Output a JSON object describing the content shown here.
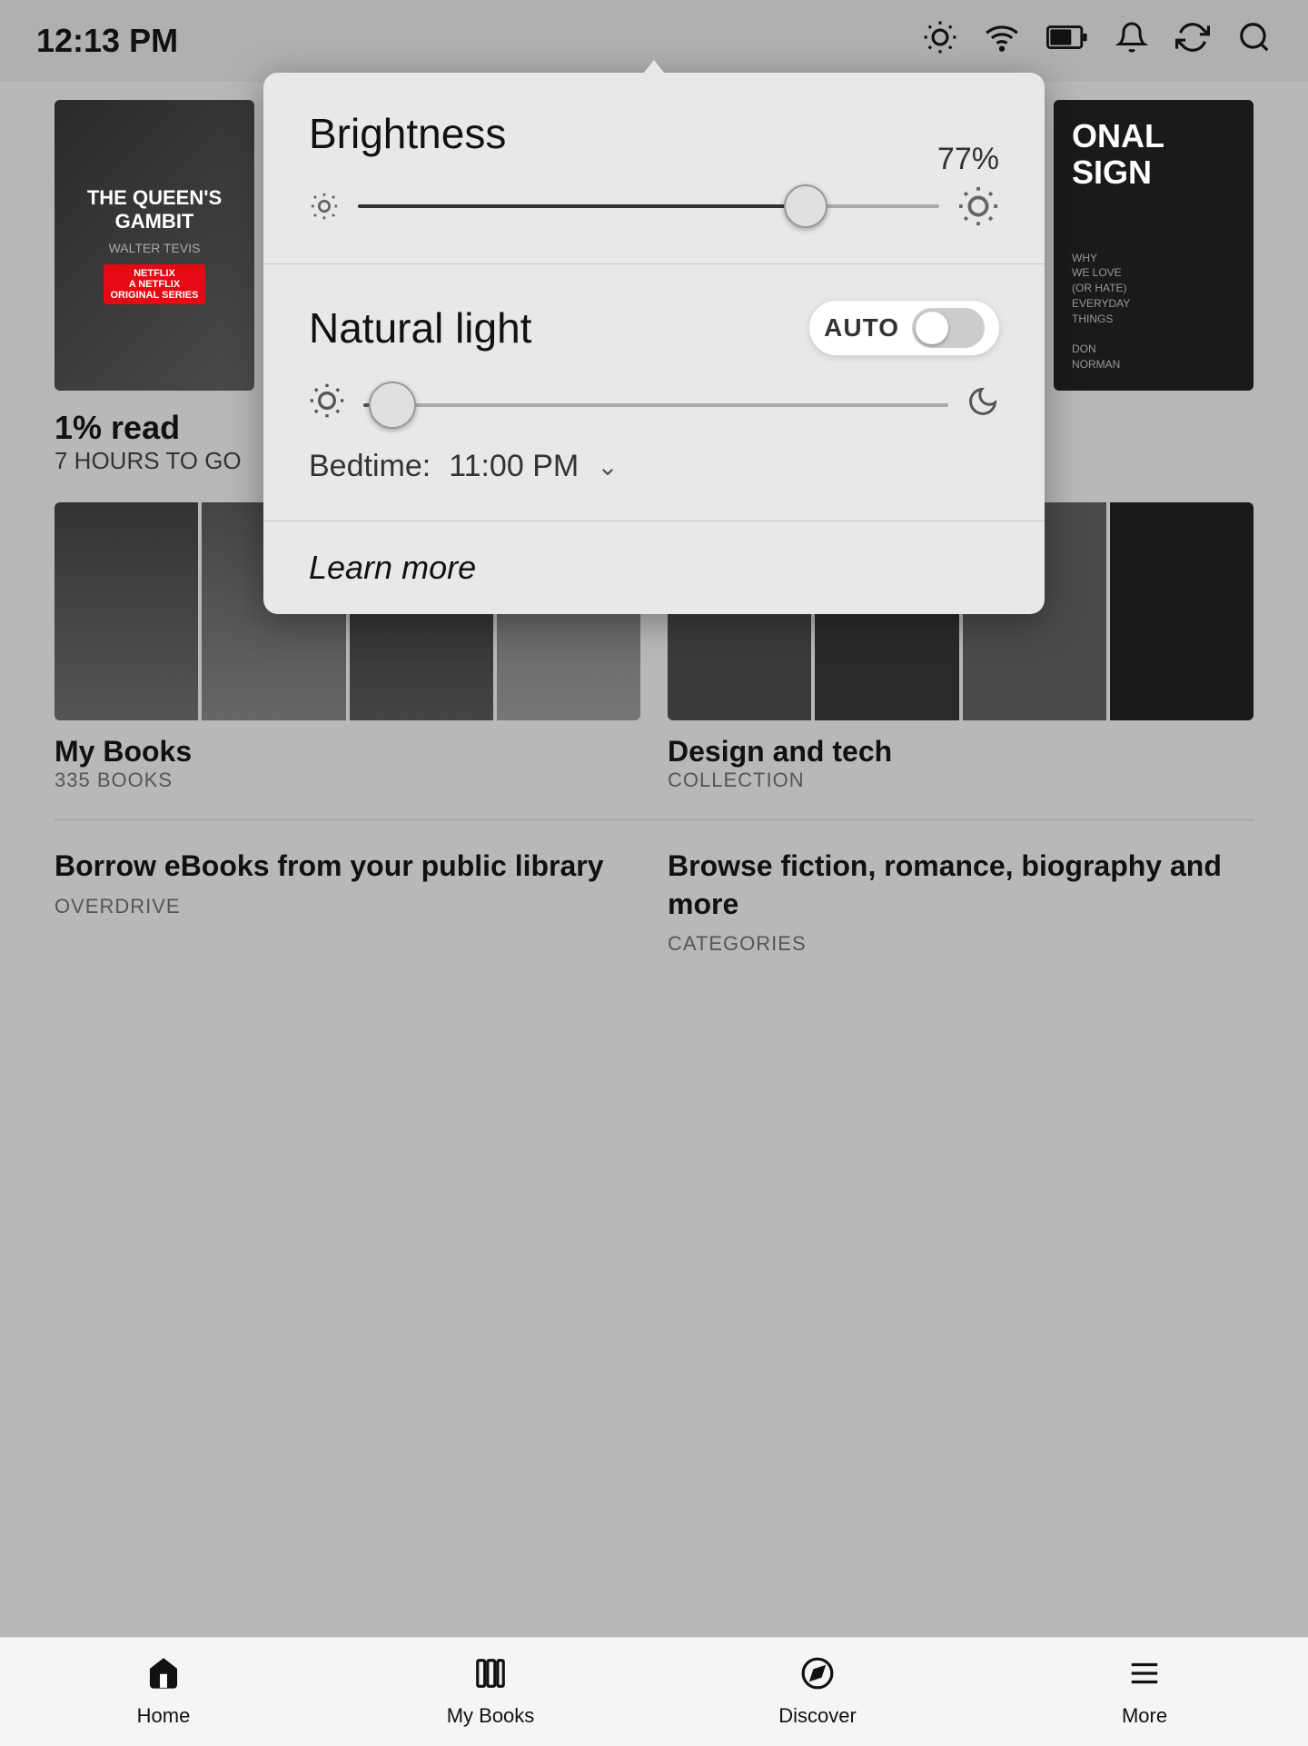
{
  "statusBar": {
    "time": "12:13 PM"
  },
  "brightnessPanel": {
    "title": "Brightness",
    "brightnessValue": "77%",
    "brightnessPercent": 77,
    "naturalLightTitle": "Natural light",
    "autoLabel": "AUTO",
    "naturalLightPercent": 5,
    "bedtimeLabel": "Bedtime:",
    "bedtimeValue": "11:00 PM",
    "learnMoreLabel": "Learn more"
  },
  "backgroundContent": {
    "book1": {
      "title": "THE QUEEN'S GAMBIT",
      "author": "WALTER TEVIS",
      "badge": "NETFLIX\nA NETFLIX\nORIGINAL SERIES"
    },
    "book2": {
      "bigTitle": "ONAL\nSIGN",
      "subtitle": "WHY\nWE LOVE\n(OR HATE)\nEVERYDAY\nTHINGS",
      "author": "DON\nNORMAN"
    },
    "readInfo": {
      "percent": "1% read",
      "hoursLeft": "7 HOURS TO GO"
    },
    "myBooks": {
      "title": "My Books",
      "count": "335 BOOKS"
    },
    "designTech": {
      "title": "Design and tech",
      "subtitle": "COLLECTION"
    },
    "borrow": {
      "title": "Borrow eBooks from your public library",
      "subtitle": "OVERDRIVE"
    },
    "browse": {
      "title": "Browse fiction, romance, biography and more",
      "subtitle": "CATEGORIES"
    }
  },
  "bottomNav": {
    "items": [
      {
        "label": "Home",
        "icon": "home"
      },
      {
        "label": "My Books",
        "icon": "books"
      },
      {
        "label": "Discover",
        "icon": "compass"
      },
      {
        "label": "More",
        "icon": "menu"
      }
    ]
  }
}
